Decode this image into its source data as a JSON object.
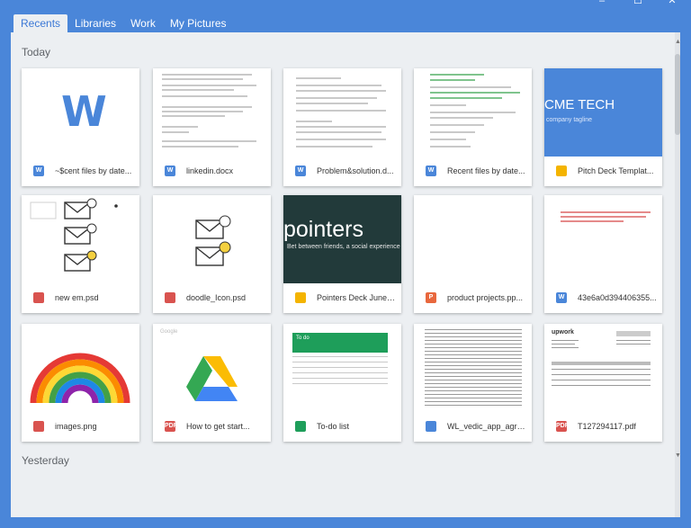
{
  "tabs": [
    {
      "label": "Recents"
    },
    {
      "label": "Libraries"
    },
    {
      "label": "Work"
    },
    {
      "label": "My Pictures"
    }
  ],
  "window_controls": {
    "minimize": "–",
    "maximize": "☐",
    "close": "✕"
  },
  "sections": {
    "today": "Today",
    "yesterday": "Yesterday"
  },
  "cards": [
    {
      "name": "~$cent files by date...",
      "icon": "word-icon",
      "icon_label": "W",
      "thumb_text": "W"
    },
    {
      "name": "linkedin.docx",
      "icon": "word-icon",
      "icon_label": "W"
    },
    {
      "name": "Problem&solution.d...",
      "icon": "word-icon",
      "icon_label": "W"
    },
    {
      "name": "Recent files by date...",
      "icon": "word-icon",
      "icon_label": "W"
    },
    {
      "name": "Pitch Deck Templat...",
      "icon": "slides-icon",
      "icon_label": "",
      "thumb_title": "CME TECH",
      "thumb_sub": "company tagline"
    },
    {
      "name": "new em.psd",
      "icon": "image-icon",
      "icon_label": ""
    },
    {
      "name": "doodle_Icon.psd",
      "icon": "image-icon",
      "icon_label": ""
    },
    {
      "name": "Pointers Deck June ...",
      "icon": "slides-icon",
      "icon_label": "",
      "thumb_title": "pointers",
      "thumb_sub": "Bet between friends, a social experience"
    },
    {
      "name": "product projects.pp...",
      "icon": "powerpoint-icon",
      "icon_label": "P"
    },
    {
      "name": "43e6a0d394406355...",
      "icon": "word-icon",
      "icon_label": "W"
    },
    {
      "name": "images.png",
      "icon": "image-icon",
      "icon_label": ""
    },
    {
      "name": "How to get start...",
      "icon": "pdf-icon",
      "icon_label": "PDF",
      "thumb_text": "Google"
    },
    {
      "name": "To-do list",
      "icon": "sheets-icon",
      "icon_label": "",
      "thumb_text": "To do"
    },
    {
      "name": "WL_vedic_app_agre...",
      "icon": "docs-icon",
      "icon_label": ""
    },
    {
      "name": "T127294117.pdf",
      "icon": "pdf-icon",
      "icon_label": "PDF",
      "thumb_text": "upwork"
    }
  ],
  "colors": {
    "brand_blue": "#4a86d9",
    "background": "#eceff2",
    "slides_yellow": "#f4b400",
    "image_red": "#d9534f",
    "sheets_green": "#1e9e5a"
  }
}
